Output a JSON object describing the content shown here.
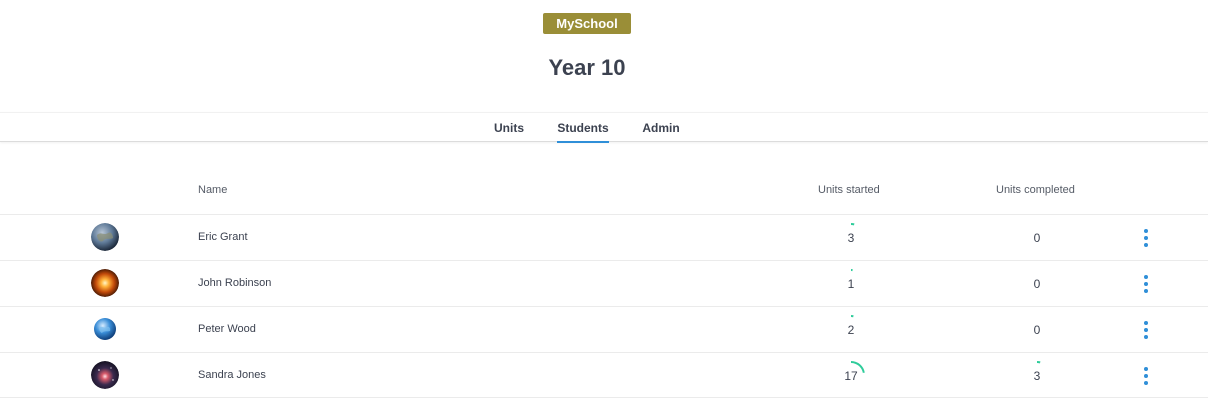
{
  "header": {
    "school_badge": "MySchool",
    "title": "Year 10"
  },
  "tabs": [
    {
      "label": "Units",
      "active": false
    },
    {
      "label": "Students",
      "active": true
    },
    {
      "label": "Admin",
      "active": false
    }
  ],
  "table": {
    "columns": {
      "name": "Name",
      "units_started": "Units started",
      "units_completed": "Units completed"
    },
    "rows": [
      {
        "name": "Eric Grant",
        "avatar": "earth-avatar",
        "units_started": "3",
        "units_completed": "0",
        "started_progress": 0.04,
        "completed_progress": 0
      },
      {
        "name": "John Robinson",
        "avatar": "sun-avatar",
        "units_started": "1",
        "units_completed": "0",
        "started_progress": 0.02,
        "completed_progress": 0
      },
      {
        "name": "Peter Wood",
        "avatar": "globe-avatar",
        "units_started": "2",
        "units_completed": "0",
        "started_progress": 0.03,
        "completed_progress": 0
      },
      {
        "name": "Sandra Jones",
        "avatar": "galaxy-avatar",
        "units_started": "17",
        "units_completed": "3",
        "started_progress": 0.22,
        "completed_progress": 0.04
      }
    ]
  },
  "colors": {
    "badge": "#9a8e37",
    "accent": "#2f8fd8",
    "progress": "#2ecc9a",
    "text": "#3c4250"
  }
}
